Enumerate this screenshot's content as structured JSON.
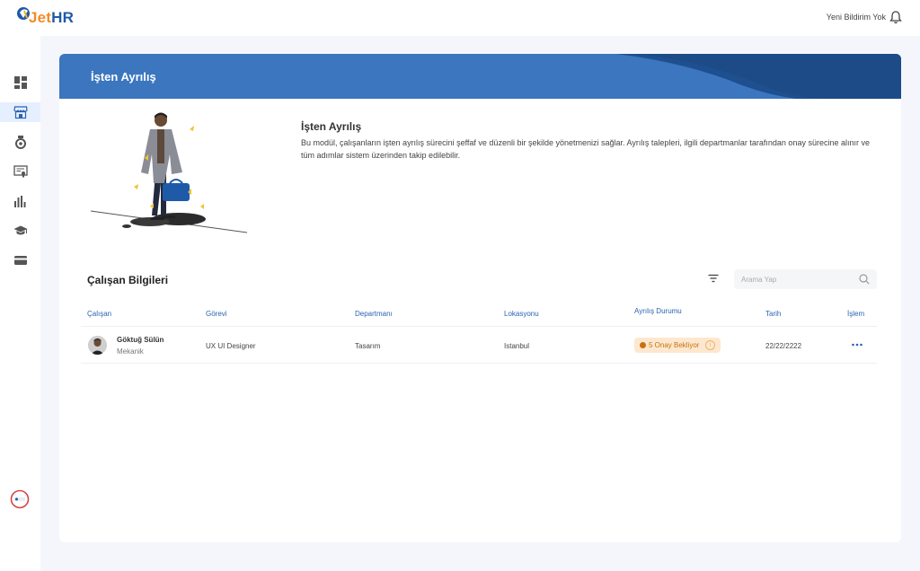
{
  "app": {
    "logo_jet": "Jet",
    "logo_hr": "HR"
  },
  "header": {
    "notification_text": "Yeni Bildirim Yok"
  },
  "sidebar": {
    "items": [
      {
        "icon": "dashboard-icon"
      },
      {
        "icon": "store-icon",
        "active": true
      },
      {
        "icon": "medal-icon"
      },
      {
        "icon": "certificate-icon"
      },
      {
        "icon": "bar-chart-icon"
      },
      {
        "icon": "graduation-cap-icon"
      },
      {
        "icon": "credit-card-icon"
      }
    ]
  },
  "page": {
    "banner_title": "İşten Ayrılış",
    "intro_title": "İşten Ayrılış",
    "intro_desc": "Bu modül, çalışanların işten ayrılış sürecini şeffaf ve düzenli bir şekilde yönetmenizi sağlar. Ayrılış talepleri, ilgili departmanlar tarafından onay sürecine alınır ve tüm adımlar sistem üzerinden takip edilebilir."
  },
  "employees": {
    "section_title": "Çalışan Bilgileri",
    "search_placeholder": "Arama Yap",
    "columns": {
      "employee": "Çalışan",
      "position": "Görevi",
      "department": "Departmanı",
      "location": "Lokasyonu",
      "status": "Ayrılış Durumu",
      "date": "Tarih",
      "action": "İşlem"
    },
    "rows": [
      {
        "name": "Göktuğ Sülün",
        "subtitle": "Mekanik",
        "position": "UX UI Designer",
        "department": "Tasarım",
        "location": "Istanbul",
        "status": "5 Onay Bekliyor",
        "date": "22/22/2222"
      }
    ]
  },
  "colors": {
    "brand_blue": "#3b76bf",
    "brand_orange": "#f28c28",
    "status_pending": "#c8700f"
  }
}
